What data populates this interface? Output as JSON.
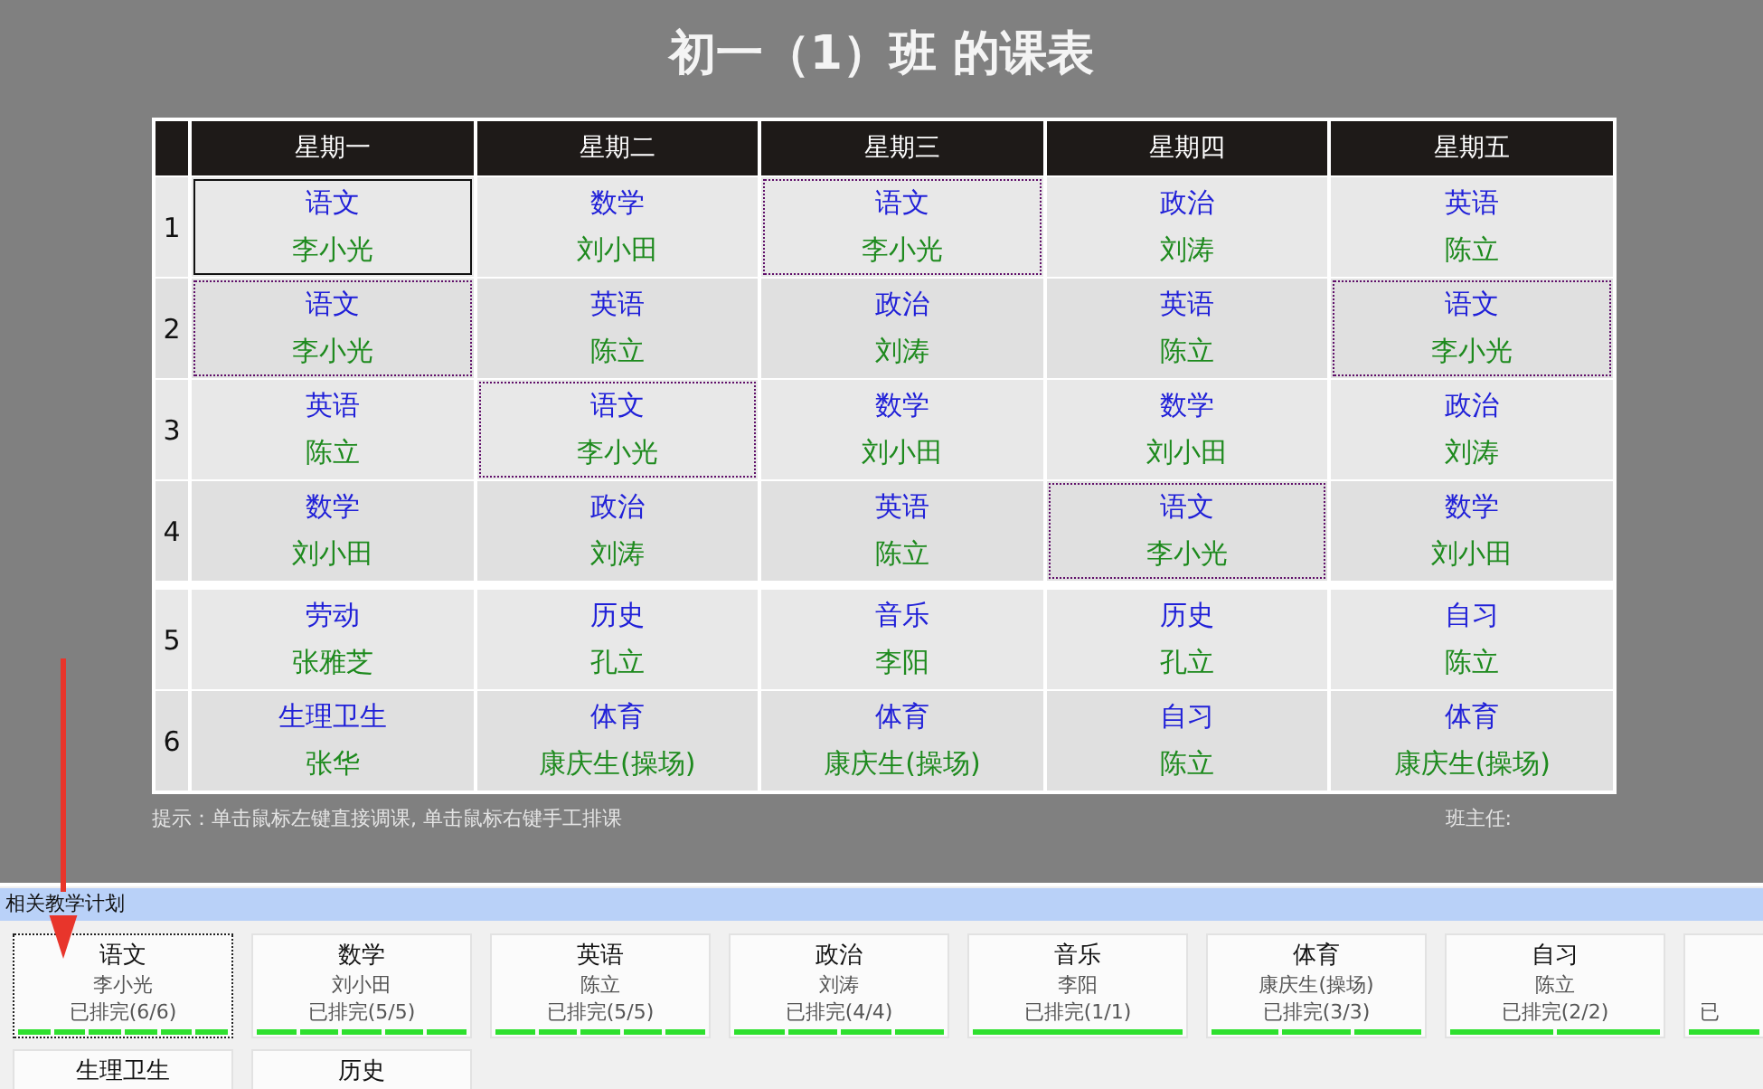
{
  "title": "初一（1）班 的课表",
  "timetable": {
    "days": [
      "星期一",
      "星期二",
      "星期三",
      "星期四",
      "星期五"
    ],
    "rows": [
      {
        "period": "1",
        "break_after": false,
        "cells": [
          {
            "subject": "语文",
            "teacher": "李小光",
            "selected": true,
            "highlighted": false
          },
          {
            "subject": "数学",
            "teacher": "刘小田",
            "selected": false,
            "highlighted": false
          },
          {
            "subject": "语文",
            "teacher": "李小光",
            "selected": false,
            "highlighted": true
          },
          {
            "subject": "政治",
            "teacher": "刘涛",
            "selected": false,
            "highlighted": false
          },
          {
            "subject": "英语",
            "teacher": "陈立",
            "selected": false,
            "highlighted": false
          }
        ]
      },
      {
        "period": "2",
        "break_after": false,
        "cells": [
          {
            "subject": "语文",
            "teacher": "李小光",
            "selected": false,
            "highlighted": true
          },
          {
            "subject": "英语",
            "teacher": "陈立",
            "selected": false,
            "highlighted": false
          },
          {
            "subject": "政治",
            "teacher": "刘涛",
            "selected": false,
            "highlighted": false
          },
          {
            "subject": "英语",
            "teacher": "陈立",
            "selected": false,
            "highlighted": false
          },
          {
            "subject": "语文",
            "teacher": "李小光",
            "selected": false,
            "highlighted": true
          }
        ]
      },
      {
        "period": "3",
        "break_after": false,
        "cells": [
          {
            "subject": "英语",
            "teacher": "陈立",
            "selected": false,
            "highlighted": false
          },
          {
            "subject": "语文",
            "teacher": "李小光",
            "selected": false,
            "highlighted": true
          },
          {
            "subject": "数学",
            "teacher": "刘小田",
            "selected": false,
            "highlighted": false
          },
          {
            "subject": "数学",
            "teacher": "刘小田",
            "selected": false,
            "highlighted": false
          },
          {
            "subject": "政治",
            "teacher": "刘涛",
            "selected": false,
            "highlighted": false
          }
        ]
      },
      {
        "period": "4",
        "break_after": true,
        "cells": [
          {
            "subject": "数学",
            "teacher": "刘小田",
            "selected": false,
            "highlighted": false
          },
          {
            "subject": "政治",
            "teacher": "刘涛",
            "selected": false,
            "highlighted": false
          },
          {
            "subject": "英语",
            "teacher": "陈立",
            "selected": false,
            "highlighted": false
          },
          {
            "subject": "语文",
            "teacher": "李小光",
            "selected": false,
            "highlighted": true
          },
          {
            "subject": "数学",
            "teacher": "刘小田",
            "selected": false,
            "highlighted": false
          }
        ]
      },
      {
        "period": "5",
        "break_after": false,
        "cells": [
          {
            "subject": "劳动",
            "teacher": "张雅芝",
            "selected": false,
            "highlighted": false
          },
          {
            "subject": "历史",
            "teacher": "孔立",
            "selected": false,
            "highlighted": false
          },
          {
            "subject": "音乐",
            "teacher": "李阳",
            "selected": false,
            "highlighted": false
          },
          {
            "subject": "历史",
            "teacher": "孔立",
            "selected": false,
            "highlighted": false
          },
          {
            "subject": "自习",
            "teacher": "陈立",
            "selected": false,
            "highlighted": false
          }
        ]
      },
      {
        "period": "6",
        "break_after": false,
        "cells": [
          {
            "subject": "生理卫生",
            "teacher": "张华",
            "selected": false,
            "highlighted": false
          },
          {
            "subject": "体育",
            "teacher": "康庆生(操场)",
            "selected": false,
            "highlighted": false
          },
          {
            "subject": "体育",
            "teacher": "康庆生(操场)",
            "selected": false,
            "highlighted": false
          },
          {
            "subject": "自习",
            "teacher": "陈立",
            "selected": false,
            "highlighted": false
          },
          {
            "subject": "体育",
            "teacher": "康庆生(操场)",
            "selected": false,
            "highlighted": false
          }
        ]
      }
    ]
  },
  "hint": "提示：单击鼠标左键直接调课, 单击鼠标右键手工排课",
  "head_teacher_label": "班主任:",
  "plan_panel": {
    "title": "相关教学计划",
    "cards": [
      {
        "kind": "full",
        "subject": "语文",
        "teacher": "李小光",
        "status": "已排完(6/6)",
        "selected": true,
        "slots": [
          {
            "done": true
          },
          {
            "done": true
          },
          {
            "done": true
          },
          {
            "done": true
          },
          {
            "done": true
          },
          {
            "done": true
          }
        ]
      },
      {
        "kind": "full",
        "subject": "数学",
        "teacher": "刘小田",
        "status": "已排完(5/5)",
        "selected": false,
        "slots": [
          {
            "done": true
          },
          {
            "done": true
          },
          {
            "done": true
          },
          {
            "done": true
          },
          {
            "done": true
          }
        ]
      },
      {
        "kind": "full",
        "subject": "英语",
        "teacher": "陈立",
        "status": "已排完(5/5)",
        "selected": false,
        "slots": [
          {
            "done": true
          },
          {
            "done": true
          },
          {
            "done": true
          },
          {
            "done": true
          },
          {
            "done": true
          }
        ]
      },
      {
        "kind": "full",
        "subject": "政治",
        "teacher": "刘涛",
        "status": "已排完(4/4)",
        "selected": false,
        "slots": [
          {
            "done": true
          },
          {
            "done": true
          },
          {
            "done": true
          },
          {
            "done": true
          }
        ]
      },
      {
        "kind": "full",
        "subject": "音乐",
        "teacher": "李阳",
        "status": "已排完(1/1)",
        "selected": false,
        "slots": [
          {
            "done": true
          }
        ]
      },
      {
        "kind": "full",
        "subject": "体育",
        "teacher": "康庆生(操场)",
        "status": "已排完(3/3)",
        "selected": false,
        "slots": [
          {
            "done": true
          },
          {
            "done": true
          },
          {
            "done": true
          }
        ]
      },
      {
        "kind": "full",
        "subject": "自习",
        "teacher": "陈立",
        "status": "已排完(2/2)",
        "selected": false,
        "slots": [
          {
            "done": true
          },
          {
            "done": true
          }
        ]
      },
      {
        "kind": "clipped",
        "status": "已",
        "selected": false,
        "slots": [
          {
            "done": true
          }
        ]
      },
      {
        "kind": "full",
        "subject": "生理卫生",
        "selected": false
      },
      {
        "kind": "full",
        "subject": "历史",
        "selected": false
      }
    ]
  }
}
